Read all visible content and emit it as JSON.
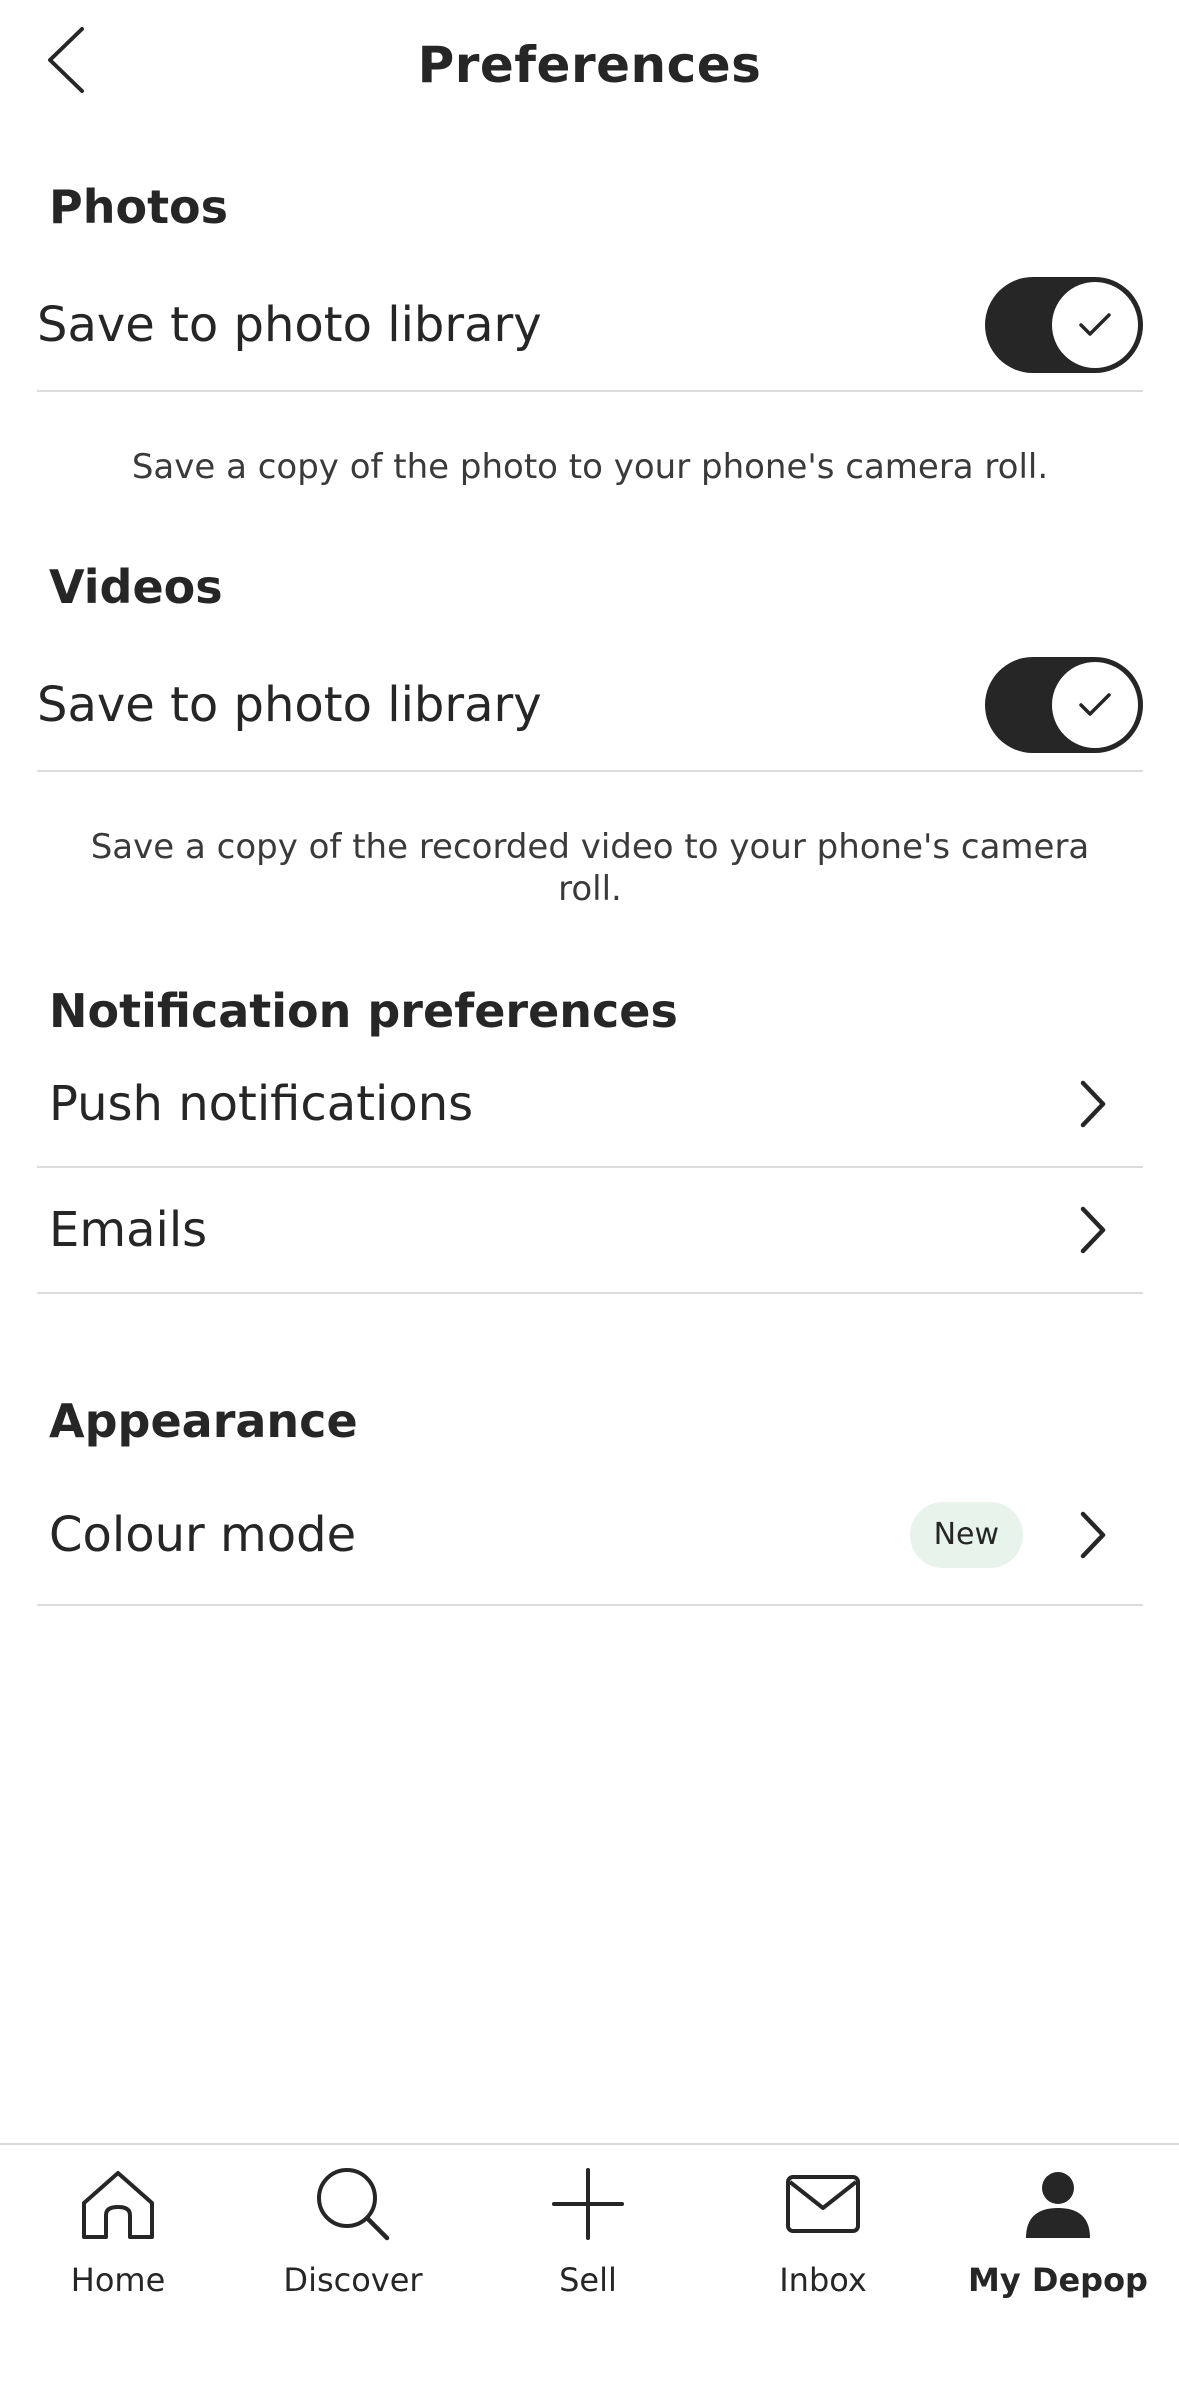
{
  "header": {
    "title": "Preferences",
    "back_icon": "chevron-left-icon"
  },
  "photos": {
    "section_title": "Photos",
    "save_label": "Save to photo library",
    "save_enabled": true,
    "helper": "Save a copy of the photo to your phone's camera roll."
  },
  "videos": {
    "section_title": "Videos",
    "save_label": "Save to photo library",
    "save_enabled": true,
    "helper": "Save a copy of the recorded video to your phone's camera roll."
  },
  "notifications": {
    "section_title": "Notification preferences",
    "items": [
      {
        "label": "Push notifications"
      },
      {
        "label": "Emails"
      }
    ]
  },
  "appearance": {
    "section_title": "Appearance",
    "colour_mode_label": "Colour mode",
    "colour_mode_badge": "New"
  },
  "tabbar": {
    "items": [
      {
        "label": "Home",
        "icon": "home-icon"
      },
      {
        "label": "Discover",
        "icon": "search-icon"
      },
      {
        "label": "Sell",
        "icon": "plus-icon"
      },
      {
        "label": "Inbox",
        "icon": "mail-icon"
      },
      {
        "label": "My Depop",
        "icon": "user-icon",
        "active": true
      }
    ]
  },
  "colors": {
    "toggle_on": "#262626",
    "badge_bg": "#e8f3ec",
    "divider": "#dcdcdc"
  }
}
